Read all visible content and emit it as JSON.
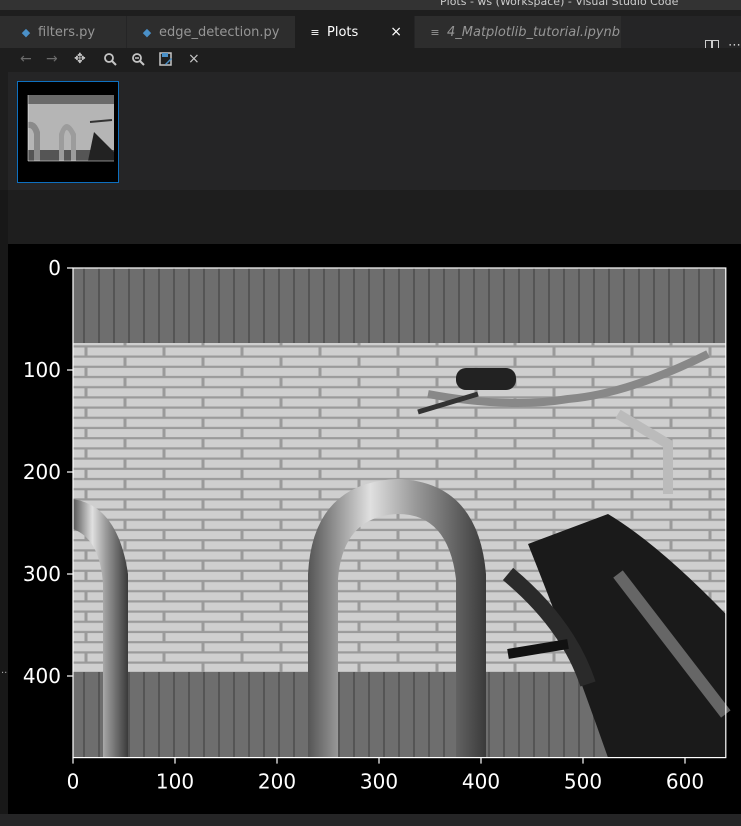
{
  "window": {
    "title": "Plots - ws (Workspace) - Visual Studio Code"
  },
  "tabs": [
    {
      "label": "filters.py",
      "active": false
    },
    {
      "label": "edge_detection.py",
      "active": false
    },
    {
      "label": "Plots",
      "active": true,
      "close_glyph": "×"
    },
    {
      "label": "4_Matplotlib_tutorial.ipynb",
      "active": false
    }
  ],
  "toolbar": {
    "icons": [
      "arrow-left-icon",
      "arrow-right-icon",
      "pan-icon",
      "zoom-in-icon",
      "zoom-out-icon",
      "save-icon",
      "close-icon"
    ],
    "glyphs": {
      "back": "←",
      "forward": "→",
      "pan": "✥",
      "close": "×"
    }
  },
  "editor_actions": {
    "more_glyph": "⋯"
  },
  "side_marker": "..",
  "plot": {
    "x_ticks": [
      "0",
      "100",
      "200",
      "300",
      "400",
      "500",
      "600"
    ],
    "y_ticks": [
      "0",
      "100",
      "200",
      "300",
      "400"
    ]
  },
  "chart_data": {
    "type": "image",
    "xlim": [
      0,
      640
    ],
    "ylim": [
      480,
      0
    ],
    "x_tick_values": [
      0,
      100,
      200,
      300,
      400,
      500,
      600
    ],
    "y_tick_values": [
      0,
      100,
      200,
      300,
      400
    ],
    "colormap": "gray",
    "background": "#000000",
    "axis_color": "#ffffff"
  },
  "colors": {
    "accent": "#0e70c0",
    "editor_bg": "#1e1e1e",
    "tab_bg": "#2d2d2d",
    "python_icon": "#4a90c8"
  }
}
